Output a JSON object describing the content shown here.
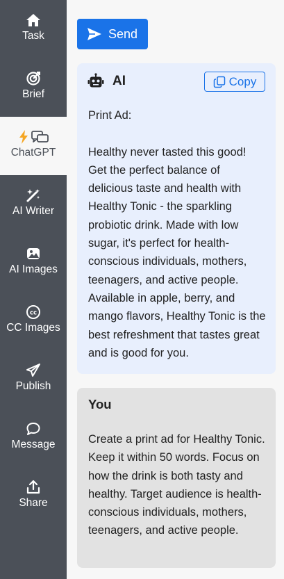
{
  "sidebar": {
    "items": [
      {
        "label": "Task",
        "icon": "home-icon"
      },
      {
        "label": "Brief",
        "icon": "target-icon"
      },
      {
        "label": "ChatGPT",
        "icon": "bolt-chat-icon",
        "active": true
      },
      {
        "label": "AI Writer",
        "icon": "magic-wand-icon"
      },
      {
        "label": "AI Images",
        "icon": "image-icon"
      },
      {
        "label": "CC Images",
        "icon": "creative-commons-icon"
      },
      {
        "label": "Publish",
        "icon": "paper-plane-icon"
      },
      {
        "label": "Message",
        "icon": "speech-bubble-icon"
      },
      {
        "label": "Share",
        "icon": "share-icon"
      }
    ]
  },
  "main": {
    "send_label": "Send",
    "ai_message": {
      "author": "AI",
      "copy_label": "Copy",
      "text": "Print Ad:\n\nHealthy never tasted this good! Get the perfect balance of delicious taste and health with Healthy Tonic - the sparkling probiotic drink. Made with low sugar, it's perfect for health-conscious individuals, mothers, teenagers, and active people. Available in apple, berry, and mango flavors, Healthy Tonic is the best refreshment that tastes great and is good for you."
    },
    "user_message": {
      "author": "You",
      "text": "Create a print ad for Healthy Tonic. Keep it within 50 words. Focus on how the drink is both tasty and healthy. Target audience is health-conscious individuals, mothers, teenagers, and active people."
    }
  },
  "colors": {
    "sidebar_bg": "#4b5058",
    "accent": "#1a73e8",
    "ai_card_bg": "#e8effd",
    "user_card_bg": "#e2e2e2",
    "bolt": "#f5a623"
  }
}
